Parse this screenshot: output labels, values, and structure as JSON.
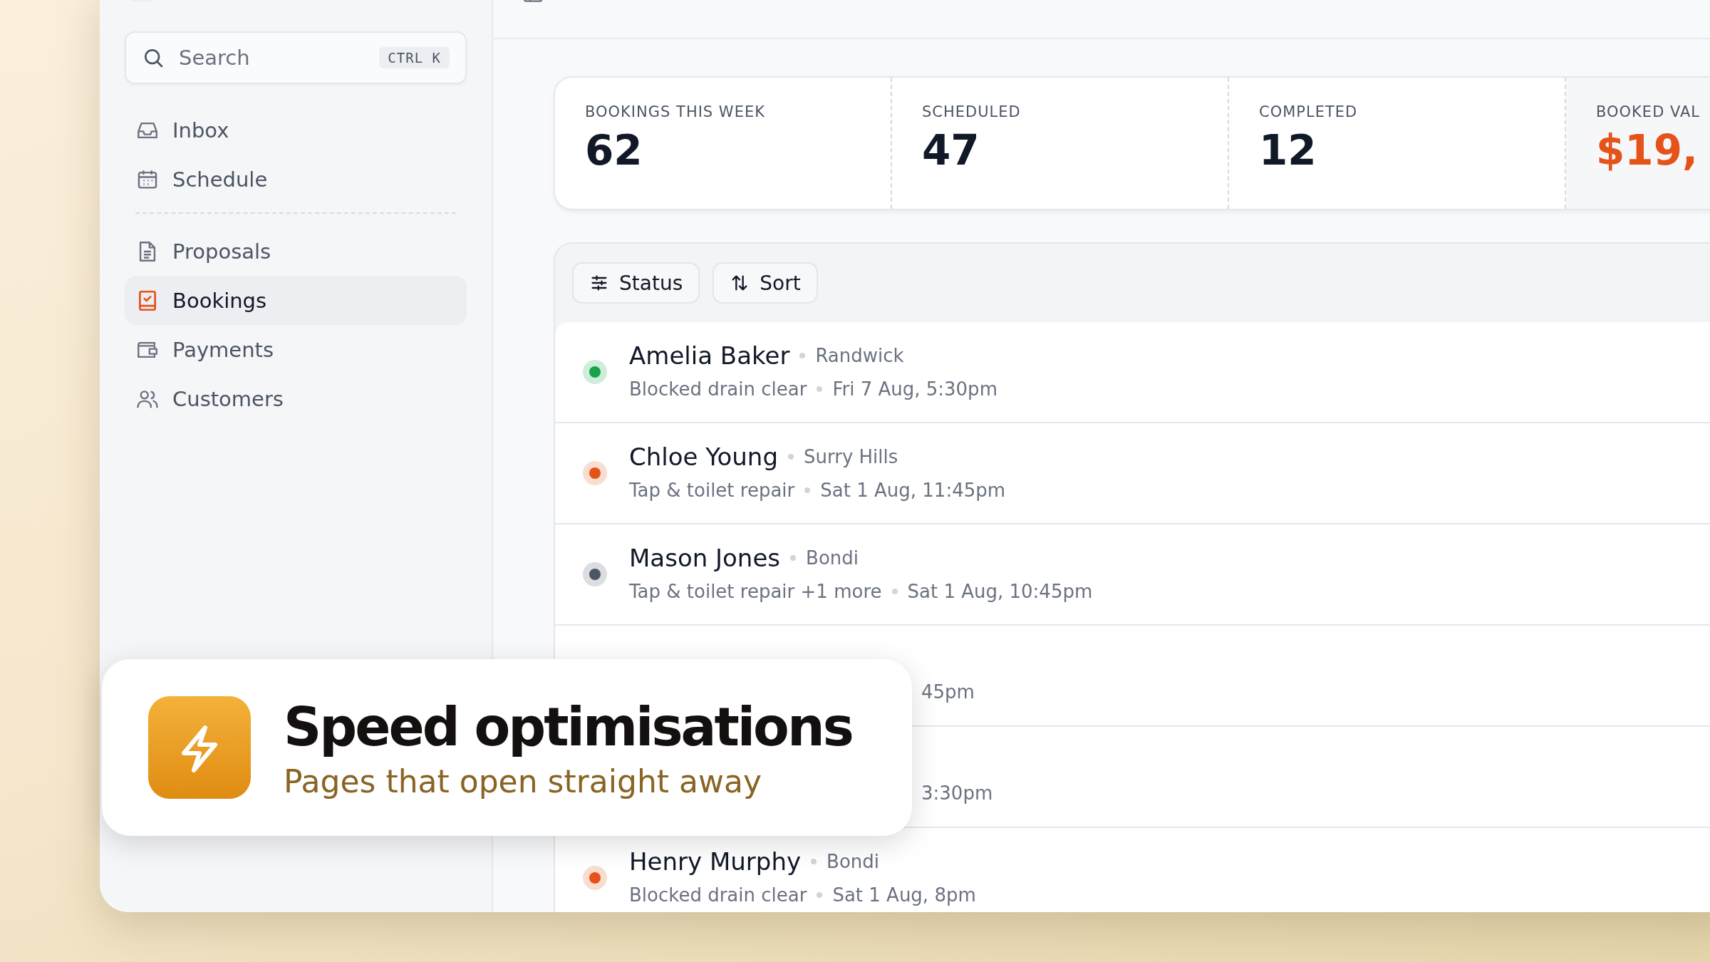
{
  "sidebar": {
    "search": {
      "placeholder": "Search",
      "shortcut": "CTRL K"
    },
    "items": [
      {
        "label": "Inbox",
        "kind": "inbox",
        "selected": false
      },
      {
        "label": "Schedule",
        "kind": "calendar",
        "selected": false
      },
      {
        "label": "Proposals",
        "kind": "document",
        "selected": false,
        "divider_before": true
      },
      {
        "label": "Bookings",
        "kind": "checklist",
        "selected": true
      },
      {
        "label": "Payments",
        "kind": "wallet",
        "selected": false
      },
      {
        "label": "Customers",
        "kind": "users",
        "selected": false
      }
    ]
  },
  "stats": [
    {
      "label": "BOOKINGS THIS WEEK",
      "value": "62",
      "kind": "plain"
    },
    {
      "label": "SCHEDULED",
      "value": "47",
      "kind": "plain"
    },
    {
      "label": "COMPLETED",
      "value": "12",
      "kind": "plain"
    },
    {
      "label": "BOOKED VAL",
      "value": "$19,",
      "kind": "accent"
    }
  ],
  "filters": [
    {
      "label": "Status",
      "kind": "sliders"
    },
    {
      "label": "Sort",
      "kind": "sort"
    }
  ],
  "bookings": [
    {
      "name": "Amelia Baker",
      "location": "Randwick",
      "service": "Blocked drain clear",
      "time": "Fri 7 Aug, 5:30pm",
      "color": "#16a34a"
    },
    {
      "name": "Chloe Young",
      "location": "Surry Hills",
      "service": "Tap & toilet repair",
      "time": "Sat 1 Aug, 11:45pm",
      "color": "#e5531a"
    },
    {
      "name": "Mason Jones",
      "location": "Bondi",
      "service": "Tap & toilet repair +1 more",
      "time": "Sat 1 Aug, 10:45pm",
      "color": "#4b5563"
    },
    {
      "time": "45pm"
    },
    {
      "time": "3:30pm"
    },
    {
      "name": "Henry Murphy",
      "location": "Bondi",
      "service": "Blocked drain clear",
      "time": "Sat 1 Aug, 8pm",
      "color": "#e5531a"
    }
  ],
  "promo": {
    "title": "Speed optimisations",
    "subtitle": "Pages that open straight away"
  }
}
